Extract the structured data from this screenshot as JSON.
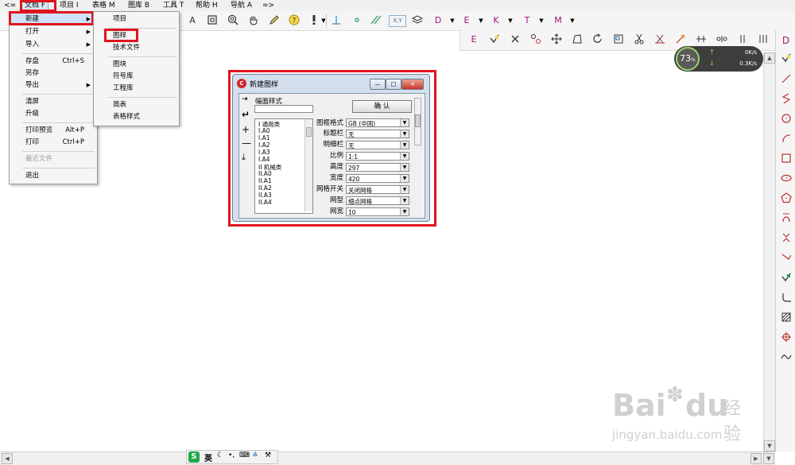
{
  "menubar": {
    "back": "<=",
    "items": [
      "文档 F",
      "项目 I",
      "表格 M",
      "图库 B",
      "工具 T",
      "帮助 H",
      "导航 A"
    ],
    "forward": "=>"
  },
  "file_menu": {
    "items": [
      {
        "label": "新建",
        "shortcut": "",
        "arrow": "▶"
      },
      {
        "label": "打开",
        "shortcut": "",
        "arrow": "▶"
      },
      {
        "label": "导入",
        "shortcut": "",
        "arrow": "▶"
      },
      {
        "label": "存盘",
        "shortcut": "Ctrl+S",
        "arrow": ""
      },
      {
        "label": "另存",
        "shortcut": "",
        "arrow": ""
      },
      {
        "label": "导出",
        "shortcut": "",
        "arrow": "▶"
      },
      {
        "label": "清屏",
        "shortcut": "",
        "arrow": ""
      },
      {
        "label": "升级",
        "shortcut": "",
        "arrow": ""
      },
      {
        "label": "打印预览",
        "shortcut": "Alt+P",
        "arrow": ""
      },
      {
        "label": "打印",
        "shortcut": "Ctrl+P",
        "arrow": ""
      },
      {
        "label": "最近文件",
        "shortcut": "",
        "arrow": ""
      },
      {
        "label": "退出",
        "shortcut": "",
        "arrow": ""
      }
    ]
  },
  "new_submenu": {
    "items": [
      "项目",
      "图样",
      "技术文件",
      "图块",
      "符号库",
      "工程库",
      "简表",
      "表格样式"
    ]
  },
  "toolbar": {
    "letters": [
      "A",
      "D",
      "E",
      "K",
      "T",
      "M"
    ],
    "xy_label": "X,Y",
    "row2_letters": [
      "D",
      "E"
    ]
  },
  "hud": {
    "percent": "73",
    "percent_unit": "%",
    "up_rate": "0K/s",
    "down_rate": "0.3K/s"
  },
  "dialog": {
    "title": "新建图样",
    "section_label": "幅面样式",
    "confirm_label": "确  认",
    "list_items": [
      "I 通用类",
      "I.A0",
      "I.A1",
      "I.A2",
      "I.A3",
      "I.A4",
      "II 机械类",
      "II.A0",
      "II.A1",
      "II.A2",
      "II.A3",
      "II.A4"
    ],
    "fields": [
      {
        "label": "图框格式",
        "value": "GB (中国)"
      },
      {
        "label": "标题栏",
        "value": "无"
      },
      {
        "label": "明细栏",
        "value": "无"
      },
      {
        "label": "比例",
        "value": "1:1"
      },
      {
        "label": "高度",
        "value": "297"
      },
      {
        "label": "宽度",
        "value": "420"
      },
      {
        "label": "网格开关",
        "value": "关闭网格"
      },
      {
        "label": "网型",
        "value": "细点网格"
      },
      {
        "label": "网宽",
        "value": "10"
      }
    ]
  },
  "ime": {
    "logo": "S",
    "lang": "英"
  },
  "watermark": {
    "brand_a": "Bai",
    "brand_b": "du",
    "brand_cn": "经验",
    "url": "jingyan.baidu.com"
  },
  "colors": {
    "highlight_red": "#e0141e",
    "letter_purple": "#a01478",
    "dialog_frame": "#d4dfee"
  }
}
